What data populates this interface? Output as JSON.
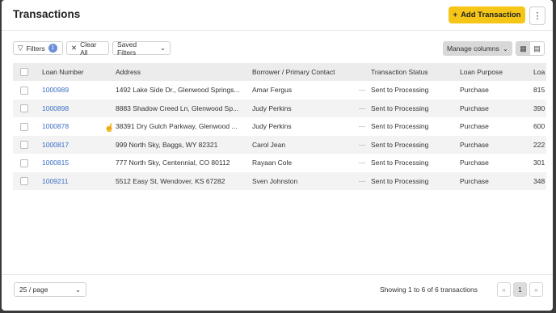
{
  "header": {
    "title": "Transactions",
    "add_label": "Add Transaction",
    "add_icon": "+",
    "more_icon": "⋮"
  },
  "toolbar": {
    "filters_label": "Filters",
    "filters_count": "1",
    "clear_label": "Clear All",
    "saved_label": "Saved Filters",
    "manage_label": "Manage columns"
  },
  "table": {
    "columns": [
      "Loan Number",
      "Address",
      "Borrower / Primary Contact",
      "",
      "Transaction Status",
      "Loan Purpose",
      "Loa"
    ],
    "rows": [
      {
        "loan": "1000989",
        "address": "1492 Lake Side Dr., Glenwood Springs...",
        "borrower": "Amar Fergus",
        "status": "Sent to Processing",
        "purpose": "Purchase",
        "amount": "815"
      },
      {
        "loan": "1000898",
        "address": "8883 Shadow Creed Ln, Glenwood Sp...",
        "borrower": "Judy Perkins",
        "status": "Sent to Processing",
        "purpose": "Purchase",
        "amount": "390"
      },
      {
        "loan": "1000878",
        "address": "38391 Dry Gulch Parkway, Glenwood ...",
        "borrower": "Judy Perkins",
        "status": "Sent to Processing",
        "purpose": "Purchase",
        "amount": "600"
      },
      {
        "loan": "1000817",
        "address": "999 North Sky, Baggs, WY 82321",
        "borrower": "Carol Jean",
        "status": "Sent to Processing",
        "purpose": "Purchase",
        "amount": "222"
      },
      {
        "loan": "1000815",
        "address": "777 North Sky, Centennial, CO 80112",
        "borrower": "Rayaan Cole",
        "status": "Sent to Processing",
        "purpose": "Purchase",
        "amount": "301"
      },
      {
        "loan": "1009211",
        "address": "5512 Easy St, Wendover, KS 67282",
        "borrower": "Sven Johnston",
        "status": "Sent to Processing",
        "purpose": "Purchase",
        "amount": "348"
      }
    ],
    "row_menu_icon": "···"
  },
  "footer": {
    "page_size": "25 / page",
    "showing": "Showing 1 to 6 of 6 transactions",
    "current_page": "1",
    "prev_icon": "«",
    "next_icon": "»"
  },
  "colors": {
    "accent": "#f5c518",
    "link": "#3a6fc4"
  }
}
